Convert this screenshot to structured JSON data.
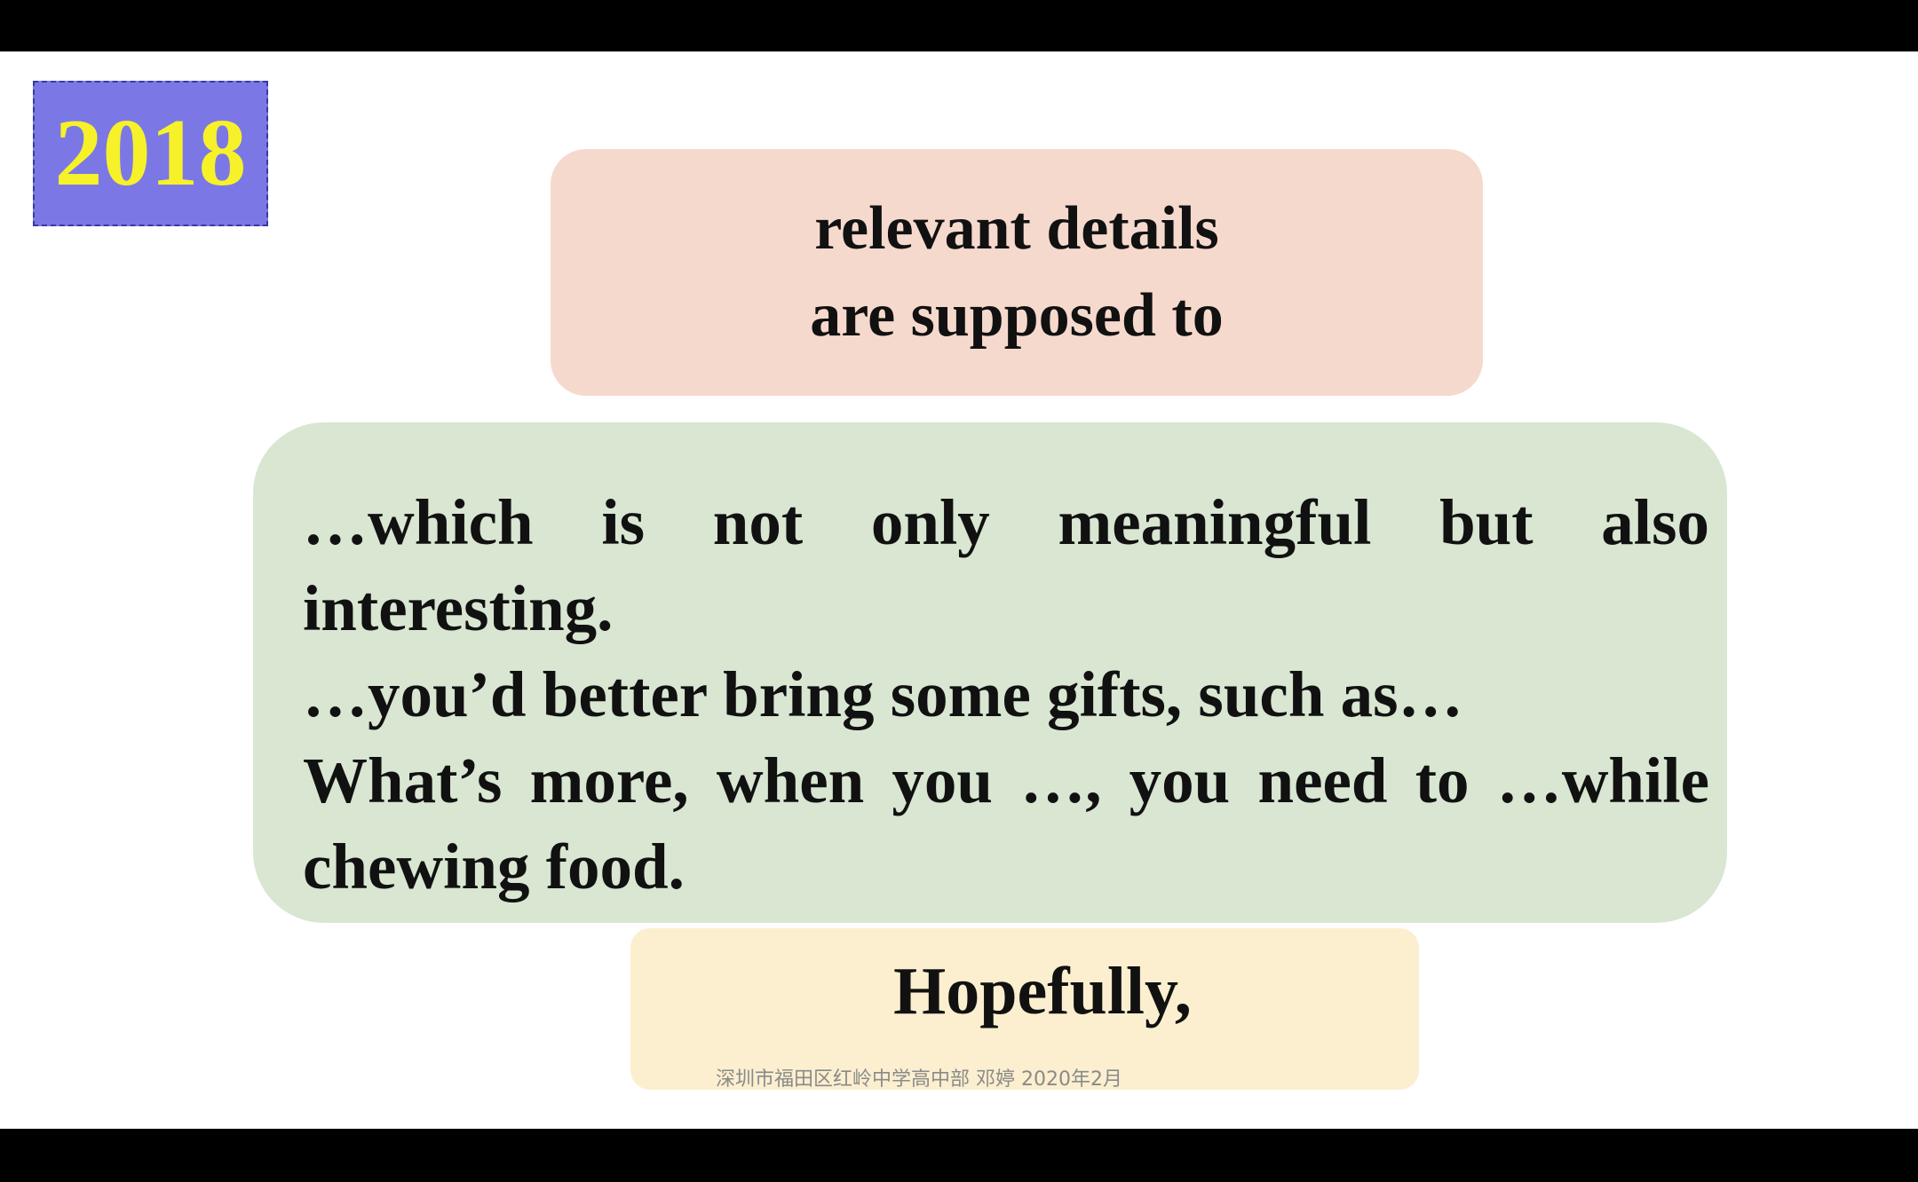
{
  "badge": {
    "year": "2018"
  },
  "top_box": {
    "line1": "relevant details",
    "line2": "are supposed to"
  },
  "middle_box": {
    "paragraph1": "…which is not only meaningful but also interesting.",
    "paragraph2": "…you’d better bring some gifts, such as…",
    "paragraph3": "What’s more, when you …, you need to …while chewing food."
  },
  "bottom_box": {
    "text": "Hopefully,"
  },
  "watermark": "深圳市福田区红岭中学高中部 邓婷 2020年2月",
  "colors": {
    "badge_bg": "#7b78e6",
    "badge_text": "#f7f12a",
    "top_box_bg": "#f6d9cd",
    "middle_box_bg": "#d8e6d2",
    "bottom_box_bg": "#fbefcf"
  }
}
